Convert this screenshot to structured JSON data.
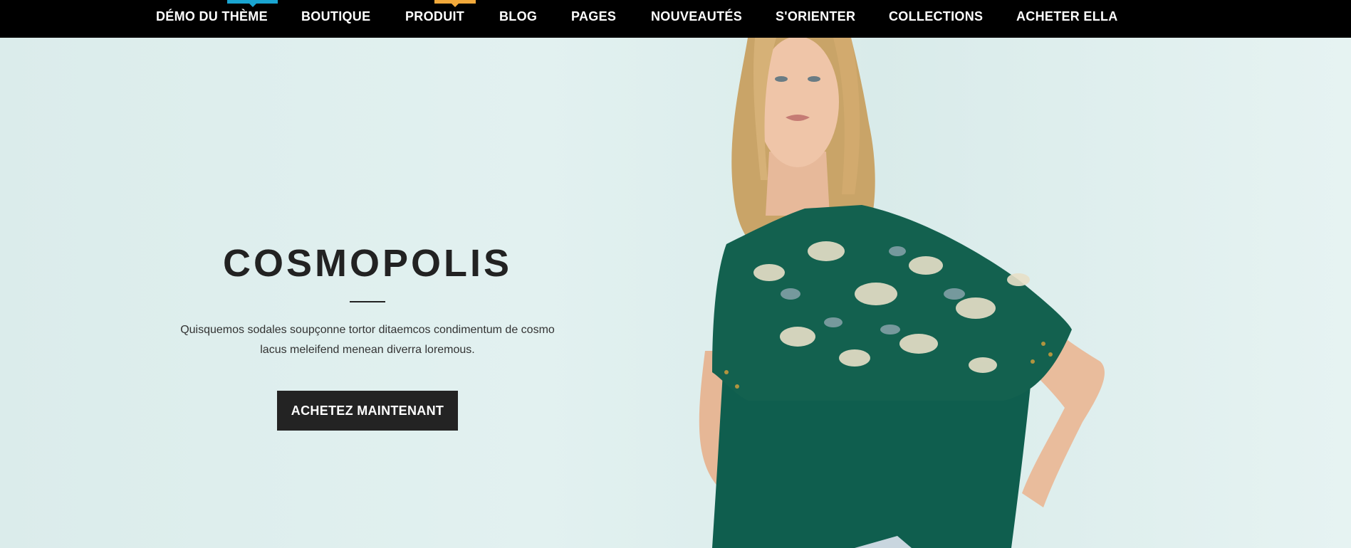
{
  "nav": {
    "items": [
      {
        "label": "DÉMO DU THÈME",
        "badge_color": "#1aa5d1"
      },
      {
        "label": "BOUTIQUE"
      },
      {
        "label": "PRODUIT",
        "badge_color": "#f2a93b"
      },
      {
        "label": "BLOG"
      },
      {
        "label": "PAGES"
      },
      {
        "label": "NOUVEAUTÉS"
      },
      {
        "label": "S'ORIENTER"
      },
      {
        "label": "COLLECTIONS"
      },
      {
        "label": "ACHETER ELLA"
      }
    ]
  },
  "hero": {
    "title": "COSMOPOLIS",
    "description": "Quisquemos sodales soupçonne tortor ditaemcos condimentum de cosmo lacus meleifend menean diverra loremous.",
    "cta_label": "ACHETEZ MAINTENANT",
    "background_color": "#dfeeee",
    "shirt_color": "#0f5e4e"
  }
}
